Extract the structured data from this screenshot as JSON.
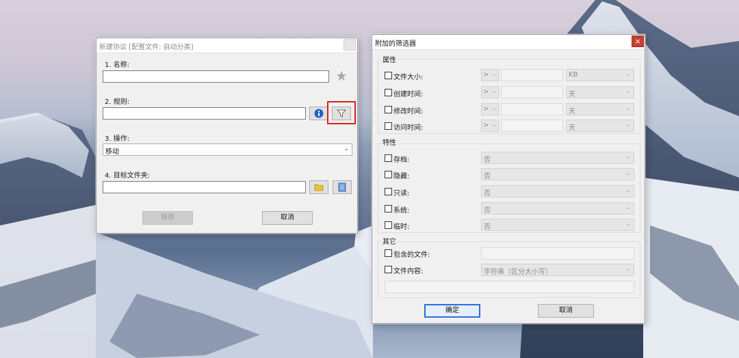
{
  "colors": {
    "close_button": "#c84031",
    "highlight_frame": "#e01b1b",
    "default_button_border": "#2a6fd6",
    "window_bg": "#f0f0f0"
  },
  "left_window": {
    "title": "新建协议 [配置文件: 自动分类]",
    "name_label": "1. 名称:",
    "name_value": "",
    "rule_label": "2. 规则:",
    "rule_value": "",
    "action_label": "3. 操作:",
    "action_value": "移动",
    "folder_label": "4. 目标文件夹:",
    "folder_value": "",
    "save_label": "保存",
    "cancel_label": "取消",
    "icons": [
      "star-icon",
      "info-icon",
      "filter-icon",
      "folder-icon",
      "book-icon"
    ]
  },
  "filter_window": {
    "title": "附加的筛选器",
    "close_symbol": "×",
    "properties_group": "属性",
    "properties": [
      {
        "label": "文件大小:",
        "operator": ">",
        "value": "",
        "unit": "KB"
      },
      {
        "label": "创建时间:",
        "operator": ">",
        "value": "",
        "unit": "天"
      },
      {
        "label": "修改时间:",
        "operator": ">",
        "value": "",
        "unit": "天"
      },
      {
        "label": "访问时间:",
        "operator": ">",
        "value": "",
        "unit": "天"
      }
    ],
    "attributes_group": "特性",
    "attributes": [
      {
        "label": "存档:",
        "value": "否"
      },
      {
        "label": "隐藏:",
        "value": "否"
      },
      {
        "label": "只读:",
        "value": "否"
      },
      {
        "label": "系统:",
        "value": "否"
      },
      {
        "label": "临时:",
        "value": "否"
      }
    ],
    "other_group": "其它",
    "include_files_label": "包含的文件:",
    "include_files_value": "",
    "content_label": "文件内容:",
    "content_mode": "字符串（区分大小写）",
    "content_text": "",
    "ok_label": "确定",
    "cancel_label": "取消"
  }
}
